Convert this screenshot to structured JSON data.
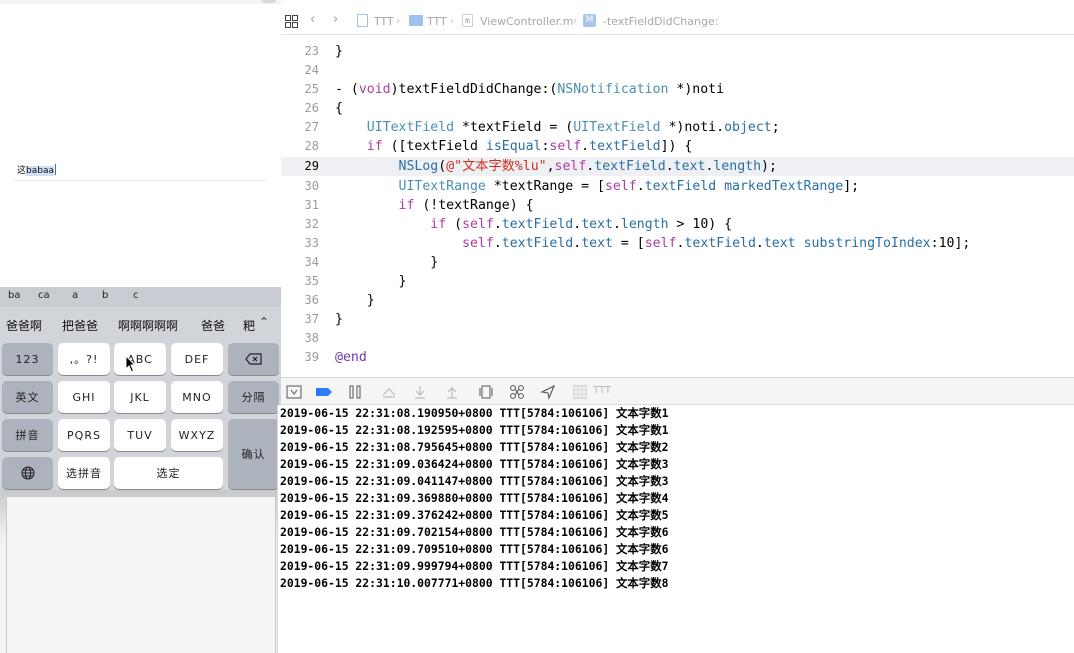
{
  "simulator": {
    "textfield": {
      "committed": "这",
      "marked": "babaa"
    },
    "keyboard": {
      "pinyin_suggestions": [
        "ba",
        "ca",
        "a",
        "b",
        "c"
      ],
      "candidates": [
        "爸爸啊",
        "把爸爸",
        "啊啊啊啊啊",
        "爸爸",
        "粑"
      ],
      "keys": {
        "num": "123",
        "punct": ",。?!",
        "abc": "ABC",
        "def": "DEF",
        "english": "英文",
        "ghi": "GHI",
        "jkl": "JKL",
        "mno": "MNO",
        "separator": "分隔",
        "pinyin": "拼音",
        "pqrs": "PQRS",
        "tuv": "TUV",
        "wxyz": "WXYZ",
        "confirm": "确认",
        "select_pinyin": "选拼音",
        "select": "选定"
      }
    }
  },
  "jumpbar": {
    "project": "TTT",
    "group": "TTT",
    "file": "ViewController.m",
    "method_badge": "M",
    "method": "-textFieldDidChange:"
  },
  "editor": {
    "current_line": "29",
    "lines": [
      {
        "n": "23"
      },
      {
        "n": "24"
      },
      {
        "n": "25"
      },
      {
        "n": "26"
      },
      {
        "n": "27"
      },
      {
        "n": "28"
      },
      {
        "n": "29"
      },
      {
        "n": "30"
      },
      {
        "n": "31"
      },
      {
        "n": "32"
      },
      {
        "n": "33"
      },
      {
        "n": "34"
      },
      {
        "n": "35"
      },
      {
        "n": "36"
      },
      {
        "n": "37"
      },
      {
        "n": "38"
      },
      {
        "n": "39"
      }
    ]
  },
  "debug_bar": {
    "process": "TTT"
  },
  "console": {
    "lines": [
      "2019-06-15 22:31:08.190950+0800 TTT[5784:106106] 文本字数1",
      "2019-06-15 22:31:08.192595+0800 TTT[5784:106106] 文本字数1",
      "2019-06-15 22:31:08.795645+0800 TTT[5784:106106] 文本字数2",
      "2019-06-15 22:31:09.036424+0800 TTT[5784:106106] 文本字数3",
      "2019-06-15 22:31:09.041147+0800 TTT[5784:106106] 文本字数3",
      "2019-06-15 22:31:09.369880+0800 TTT[5784:106106] 文本字数4",
      "2019-06-15 22:31:09.376242+0800 TTT[5784:106106] 文本字数5",
      "2019-06-15 22:31:09.702154+0800 TTT[5784:106106] 文本字数6",
      "2019-06-15 22:31:09.709510+0800 TTT[5784:106106] 文本字数6",
      "2019-06-15 22:31:09.999794+0800 TTT[5784:106106] 文本字数7",
      "2019-06-15 22:31:10.007771+0800 TTT[5784:106106] 文本字数8"
    ]
  }
}
